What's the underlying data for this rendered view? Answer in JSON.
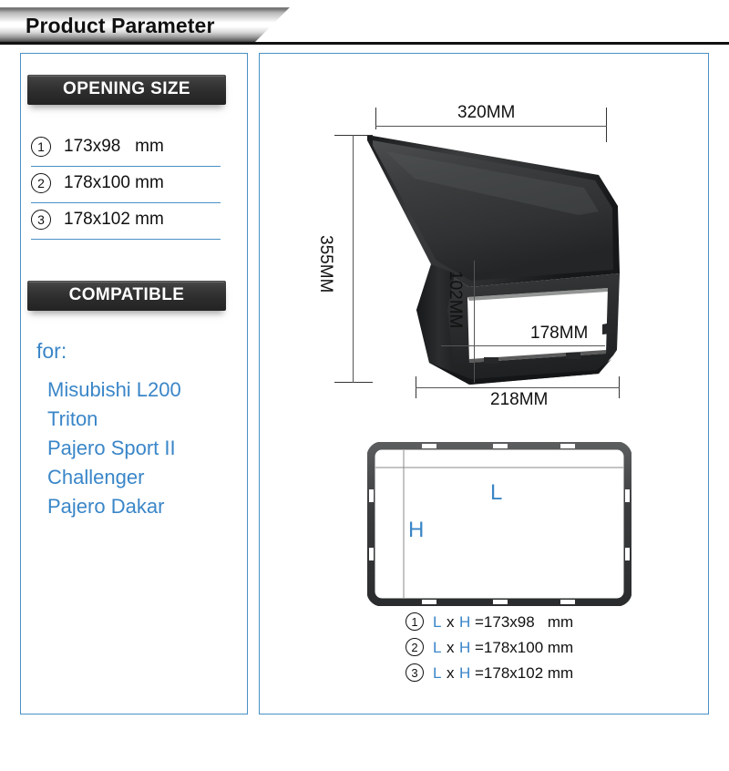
{
  "banner": {
    "title": "Product Parameter"
  },
  "left_panel": {
    "opening": {
      "header": "OPENING SIZE",
      "rows": [
        {
          "num": "1",
          "value": "173x98   mm"
        },
        {
          "num": "2",
          "value": "178x100 mm"
        },
        {
          "num": "3",
          "value": "178x102 mm"
        }
      ]
    },
    "compatible": {
      "header": "COMPATIBLE",
      "for_label": "for:",
      "items": [
        "Misubishi L200",
        "Triton",
        "Pajero Sport II",
        "Challenger",
        "Pajero Dakar"
      ]
    }
  },
  "right_panel": {
    "dimensions": {
      "top": "320MM",
      "left": "355MM",
      "bottom": "218MM",
      "inner_width": "178MM",
      "inner_height": "102MM"
    },
    "frame_diagram": {
      "length_label": "L",
      "height_label": "H"
    },
    "legend": {
      "rows": [
        {
          "num": "1",
          "l": "L",
          "times": "x",
          "h": "H",
          "value": "=173x98   mm"
        },
        {
          "num": "2",
          "l": "L",
          "times": "x",
          "h": "H",
          "value": "=178x100 mm"
        },
        {
          "num": "3",
          "l": "L",
          "times": "x",
          "h": "H",
          "value": "=178x102 mm"
        }
      ]
    }
  },
  "colors": {
    "accent_blue": "#3a86c8",
    "panel_border": "#4a90c4",
    "header_dark": "#2c2c2c",
    "product_black": "#2b2b2b"
  }
}
